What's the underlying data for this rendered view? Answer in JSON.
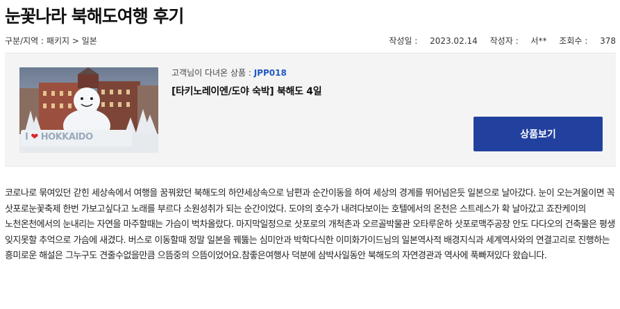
{
  "page": {
    "title": "눈꽃나라 북해도여행 후기"
  },
  "meta": {
    "category_label": "구분/지역",
    "category_value": "패키지 > 일본",
    "date_label": "작성일",
    "date_value": "2023.02.14",
    "author_label": "작성자",
    "author_value": "서**",
    "views_label": "조회수",
    "views_value": "378"
  },
  "product": {
    "code_label": "고객님이 다녀온 상품",
    "code_value": "JPP018",
    "name_prefix": "[타키노레이엔/도야 숙박] 북해도 ",
    "name_days": "4",
    "name_suffix": "일",
    "button_label": "상품보기",
    "image_sign_text": "I ❤ HOKKAIDO"
  },
  "review": {
    "body": "코로나로 묶여있던 갇힌 세상속에서 여행을 꿈꿔왔던 북해도의 하얀세상속으로 남편과 순간이동을 하여 세상의 경계를 뛰어넘은듯 일본으로 날아갔다. 눈이 오는겨울이면 꼭 삿포로눈꽃축제 한번 가보고싶다고 노래를 부르다 소원성취가 되는 순간이었다. 도야의 호수가 내려다보이는 호텔에서의 온천은 스트레스가 확 날아갔고 죠잔케이의 노천온천에서의 눈내리는 자연을 마주할때는 가슴이 벅차올랐다. 마지막일정으로 삿포로의 개척촌과 오르골박물관 오타루운하 삿포로맥주공장 안도 다다오의 건축물은 평생 잊지못할 추억으로 가슴에 새겼다. 버스로 이동할때 정말 일본을 꿰뚫는 심미안과 박학다식한 이미화가이드님의 일본역사적 배경지식과 세계역사와의 연결고리로 진행하는 흥미로운 해설은 그누구도 견줄수없을만큼 으뜸중의 으뜸이었어요.참좋은여행사 덕분에 삼박사일동안 북해도의 자연경관과 역사에 푹빠져있다 왔습니다."
  },
  "colors": {
    "button_bg": "#22419e",
    "product_code": "#1f59c4",
    "box_bg": "#f4f4f4",
    "sign_red": "#d9262b"
  }
}
